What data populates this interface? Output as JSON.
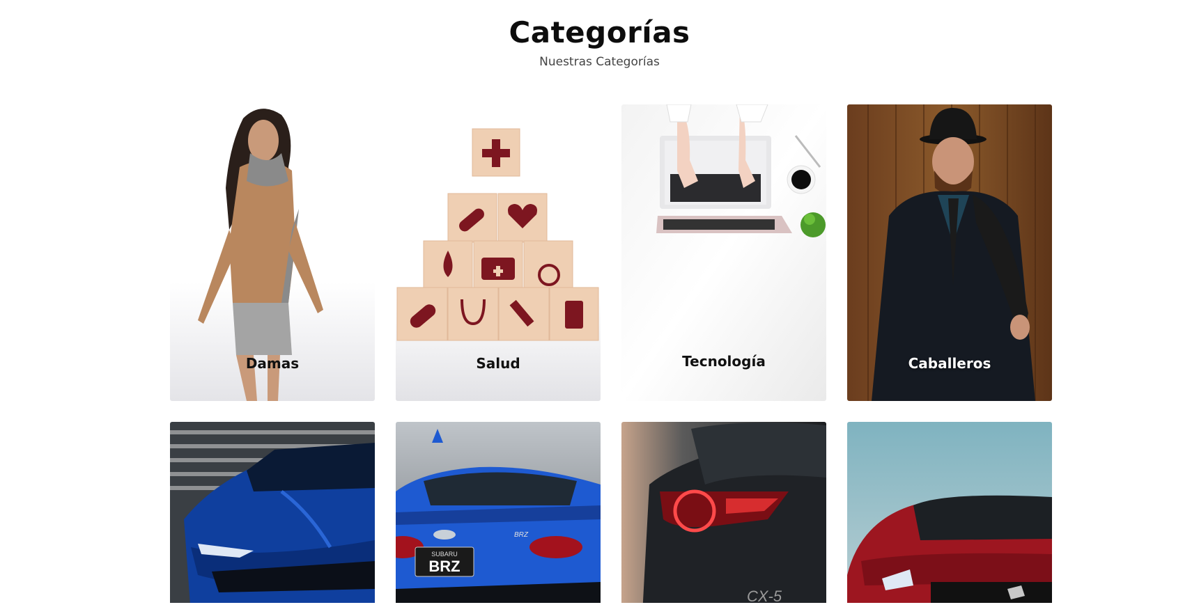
{
  "section": {
    "title": "Categorías",
    "subtitle": "Nuestras Categorías"
  },
  "categories": [
    {
      "label": "Damas"
    },
    {
      "label": "Salud"
    },
    {
      "label": "Tecnología"
    },
    {
      "label": "Caballeros"
    }
  ],
  "car_cards": [
    {
      "brand_badge": ""
    },
    {
      "plate_top": "SUBARU",
      "plate_text": "BRZ",
      "model_badge": "BRZ"
    },
    {
      "model_badge": "CX-5"
    },
    {
      "brand_badge": ""
    }
  ]
}
